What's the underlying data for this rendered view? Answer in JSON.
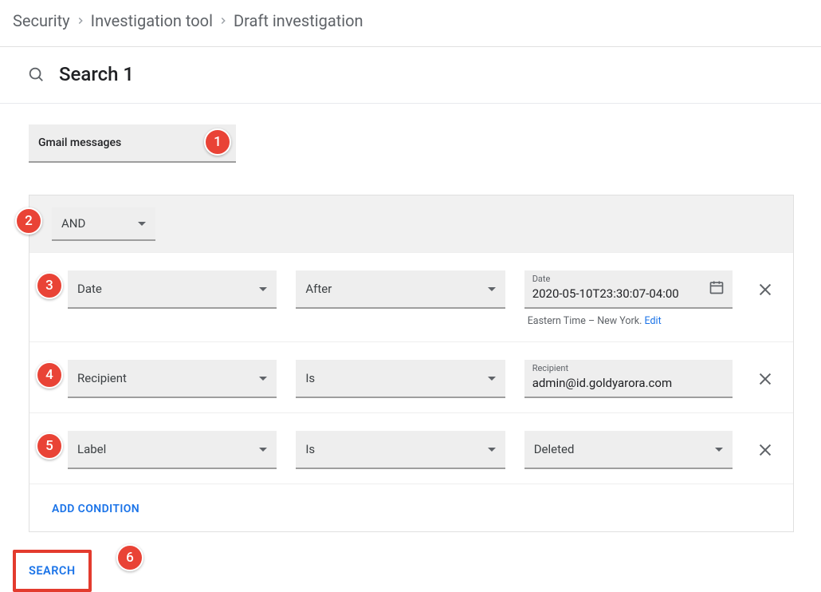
{
  "breadcrumb": {
    "items": [
      "Security",
      "Investigation tool",
      "Draft investigation"
    ]
  },
  "header": {
    "title": "Search 1"
  },
  "dataSource": {
    "value": "Gmail messages"
  },
  "logic": {
    "operator": "AND"
  },
  "conditions": [
    {
      "field": "Date",
      "operator": "After",
      "valueLabel": "Date",
      "value": "2020-05-10T23:30:07-04:00",
      "hasCalendar": true,
      "tzText": "Eastern Time – New York.",
      "tzEdit": "Edit"
    },
    {
      "field": "Recipient",
      "operator": "Is",
      "valueLabel": "Recipient",
      "value": "admin@id.goldyarora.com"
    },
    {
      "field": "Label",
      "operator": "Is",
      "valueIsSelect": true,
      "value": "Deleted"
    }
  ],
  "addCondition": "ADD CONDITION",
  "searchButton": "SEARCH",
  "annotations": [
    "1",
    "2",
    "3",
    "4",
    "5",
    "6"
  ]
}
